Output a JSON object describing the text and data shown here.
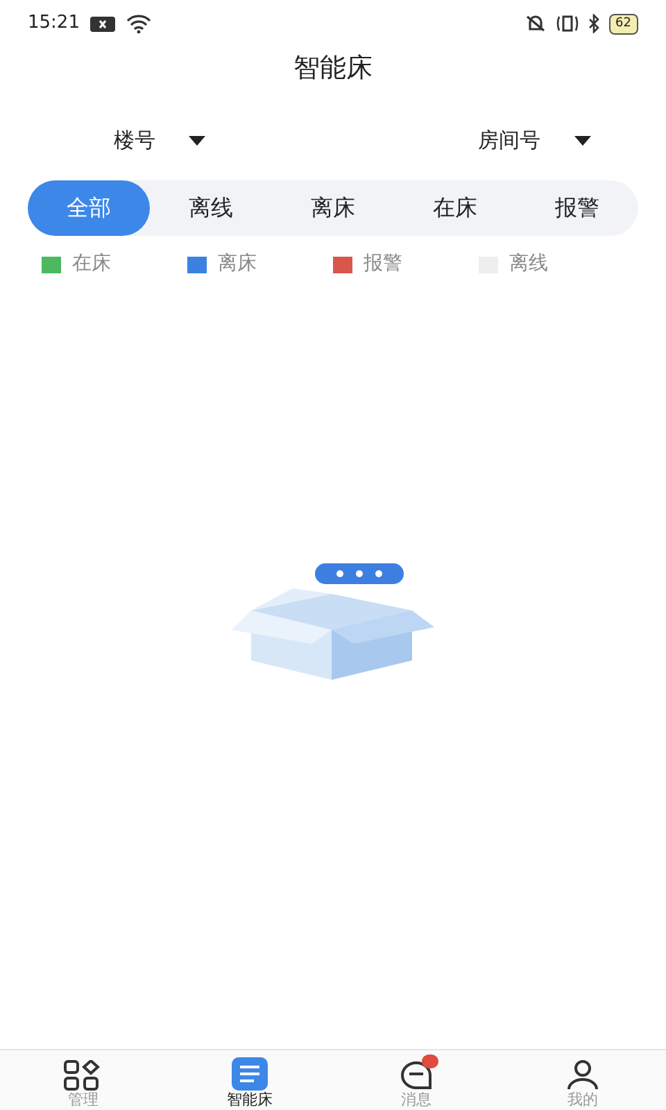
{
  "status_bar": {
    "time": "15:21",
    "battery": "62"
  },
  "title": "智能床",
  "filters": [
    {
      "label": "楼号"
    },
    {
      "label": "房间号"
    }
  ],
  "tabs": [
    {
      "label": "全部",
      "selected": true
    },
    {
      "label": "离线",
      "selected": false
    },
    {
      "label": "离床",
      "selected": false
    },
    {
      "label": "在床",
      "selected": false
    },
    {
      "label": "报警",
      "selected": false
    }
  ],
  "legend": [
    {
      "label": "在床",
      "color": "#4cb860"
    },
    {
      "label": "离床",
      "color": "#3b82e0"
    },
    {
      "label": "报警",
      "color": "#d9574a"
    },
    {
      "label": "离线",
      "color": "#eeeeee"
    }
  ],
  "bottom_nav": [
    {
      "label": "管理",
      "kind": "grid",
      "selected": false
    },
    {
      "label": "智能床",
      "kind": "list",
      "selected": true
    },
    {
      "label": "消息",
      "kind": "chat",
      "selected": false
    },
    {
      "label": "我的",
      "kind": "person",
      "selected": false
    }
  ]
}
